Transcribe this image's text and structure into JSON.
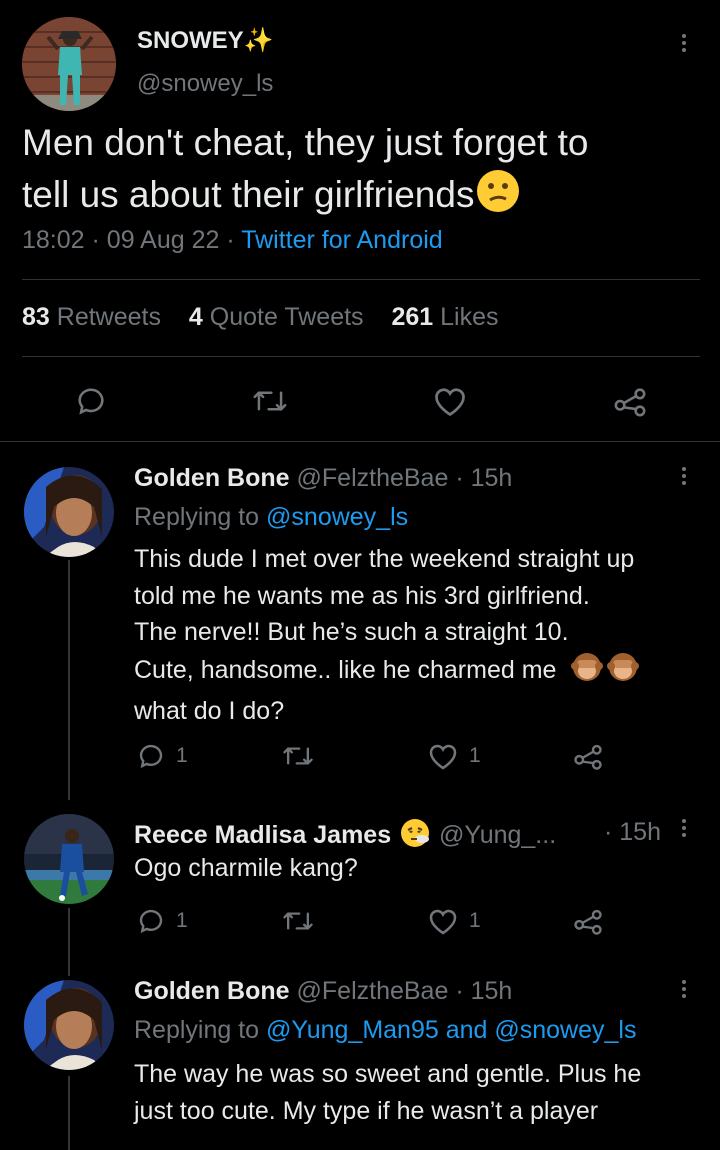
{
  "main_tweet": {
    "display_name": "SNOWEY",
    "handle": "@snowey_ls",
    "text_line1": "Men don't cheat, they just forget to",
    "text_line2": "tell us about their girlfriends",
    "time": "18:02",
    "date": "09 Aug 22",
    "source": "Twitter for Android",
    "separator": "·",
    "retweets_count": "83",
    "retweets_label": "Retweets",
    "quote_count": "4",
    "quote_label": "Quote Tweets",
    "likes_count": "261",
    "likes_label": "Likes"
  },
  "replies": [
    {
      "name": "Golden Bone",
      "handle": "@FelztheBae",
      "time": "· 15h",
      "replying_prefix": "Replying to",
      "replying_to": "@snowey_ls",
      "lines": [
        "This dude I met over the weekend straight up",
        "told me he wants me as his 3rd girlfriend.",
        "The nerve!! But he’s such a straight 10.",
        "Cute, handsome.. like he charmed me",
        "what do I do?"
      ],
      "reply_count": "1",
      "like_count": "1"
    },
    {
      "name": "Reece Madlisa James",
      "handle": "@Yung_...",
      "time": "· 15h",
      "lines": [
        "Ogo charmile kang?"
      ],
      "reply_count": "1",
      "like_count": "1"
    },
    {
      "name": "Golden Bone",
      "handle": "@FelztheBae",
      "time": "· 15h",
      "replying_prefix": "Replying to",
      "replying_to": "@Yung_Man95 and @snowey_ls",
      "lines": [
        "The way he was so sweet and gentle. Plus he",
        "just too cute. My type if he wasn’t a player"
      ]
    }
  ],
  "colors": {
    "background": "#000000",
    "text": "#e7e9ea",
    "muted": "#71767b",
    "link": "#1d9bf0",
    "divider": "#2f3336"
  }
}
